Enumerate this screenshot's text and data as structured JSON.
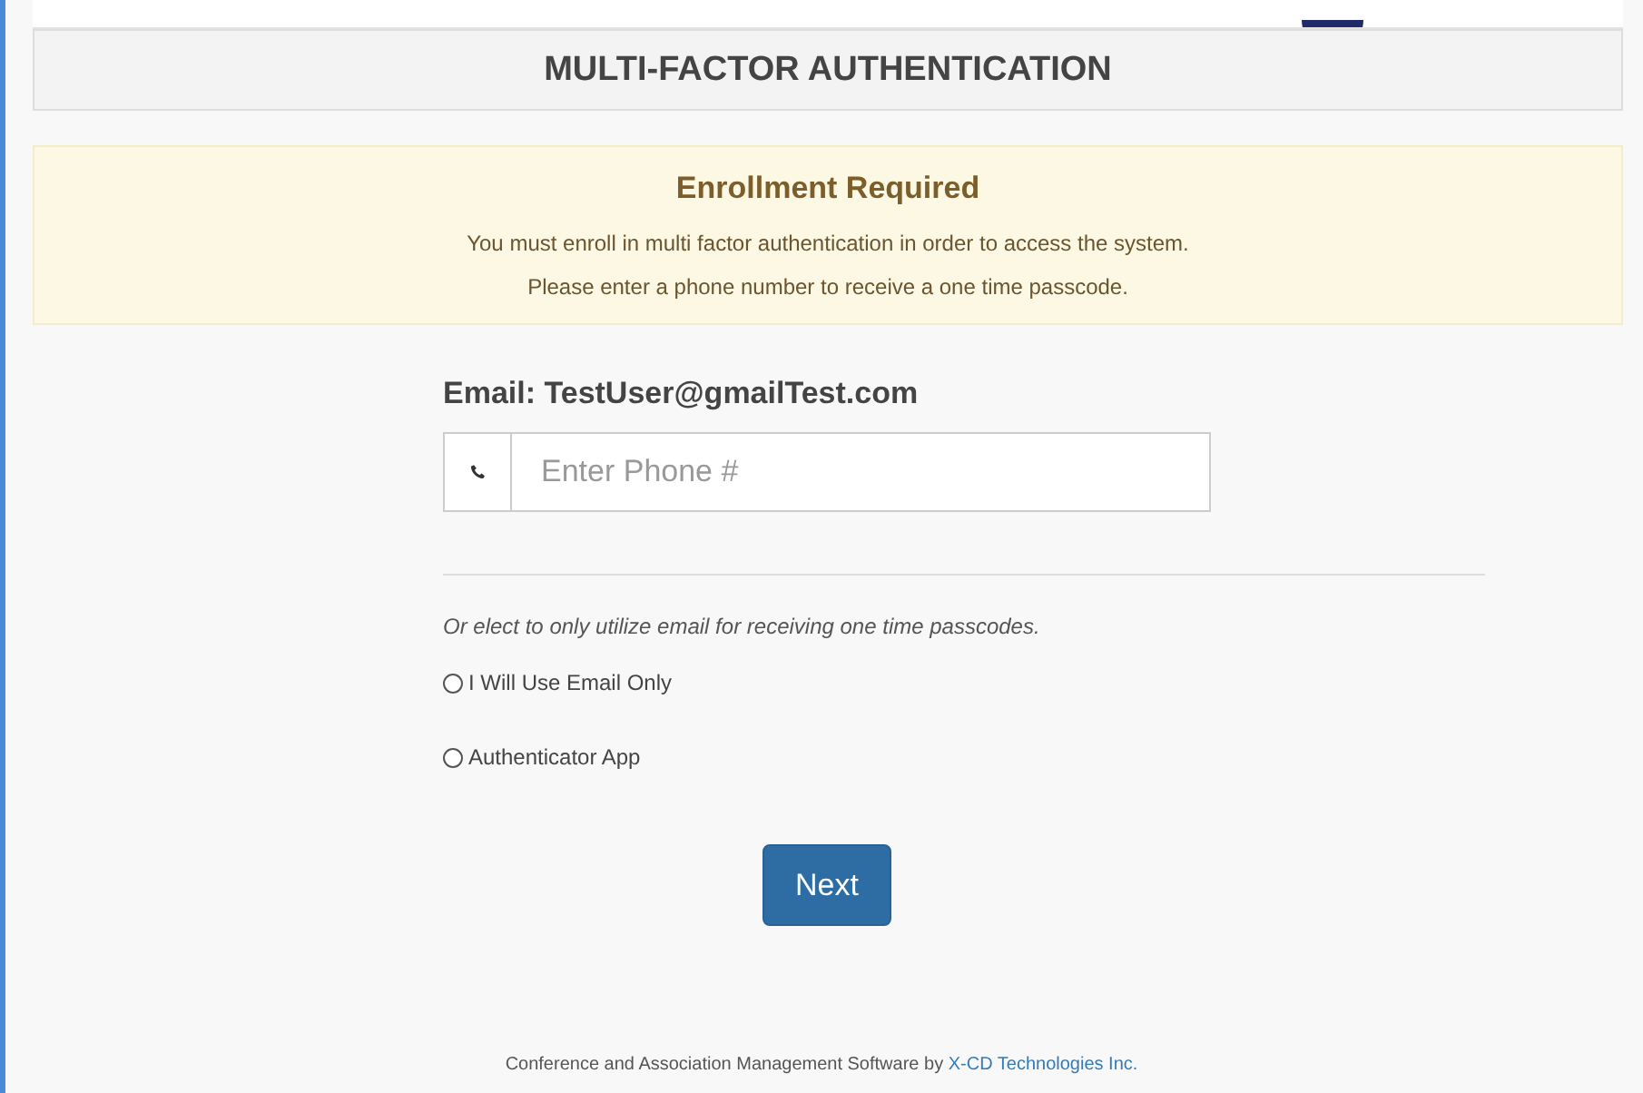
{
  "header": {
    "title": "MULTI-FACTOR AUTHENTICATION"
  },
  "alert": {
    "title": "Enrollment Required",
    "lines": [
      "You must enroll in multi factor authentication in order to access the system.",
      "Please enter a phone number to receive a one time passcode."
    ]
  },
  "form": {
    "email_label": "Email: TestUser@gmailTest.com",
    "phone": {
      "placeholder": "Enter Phone #"
    },
    "note": "Or elect to only utilize email for receiving one time passcodes.",
    "options": [
      {
        "label": "I Will Use Email Only",
        "selected": false
      },
      {
        "label": "Authenticator App",
        "selected": false
      }
    ],
    "button": "Next"
  },
  "footer": {
    "text": "Conference and Association Management Software by",
    "link": "X-CD Technologies Inc."
  }
}
